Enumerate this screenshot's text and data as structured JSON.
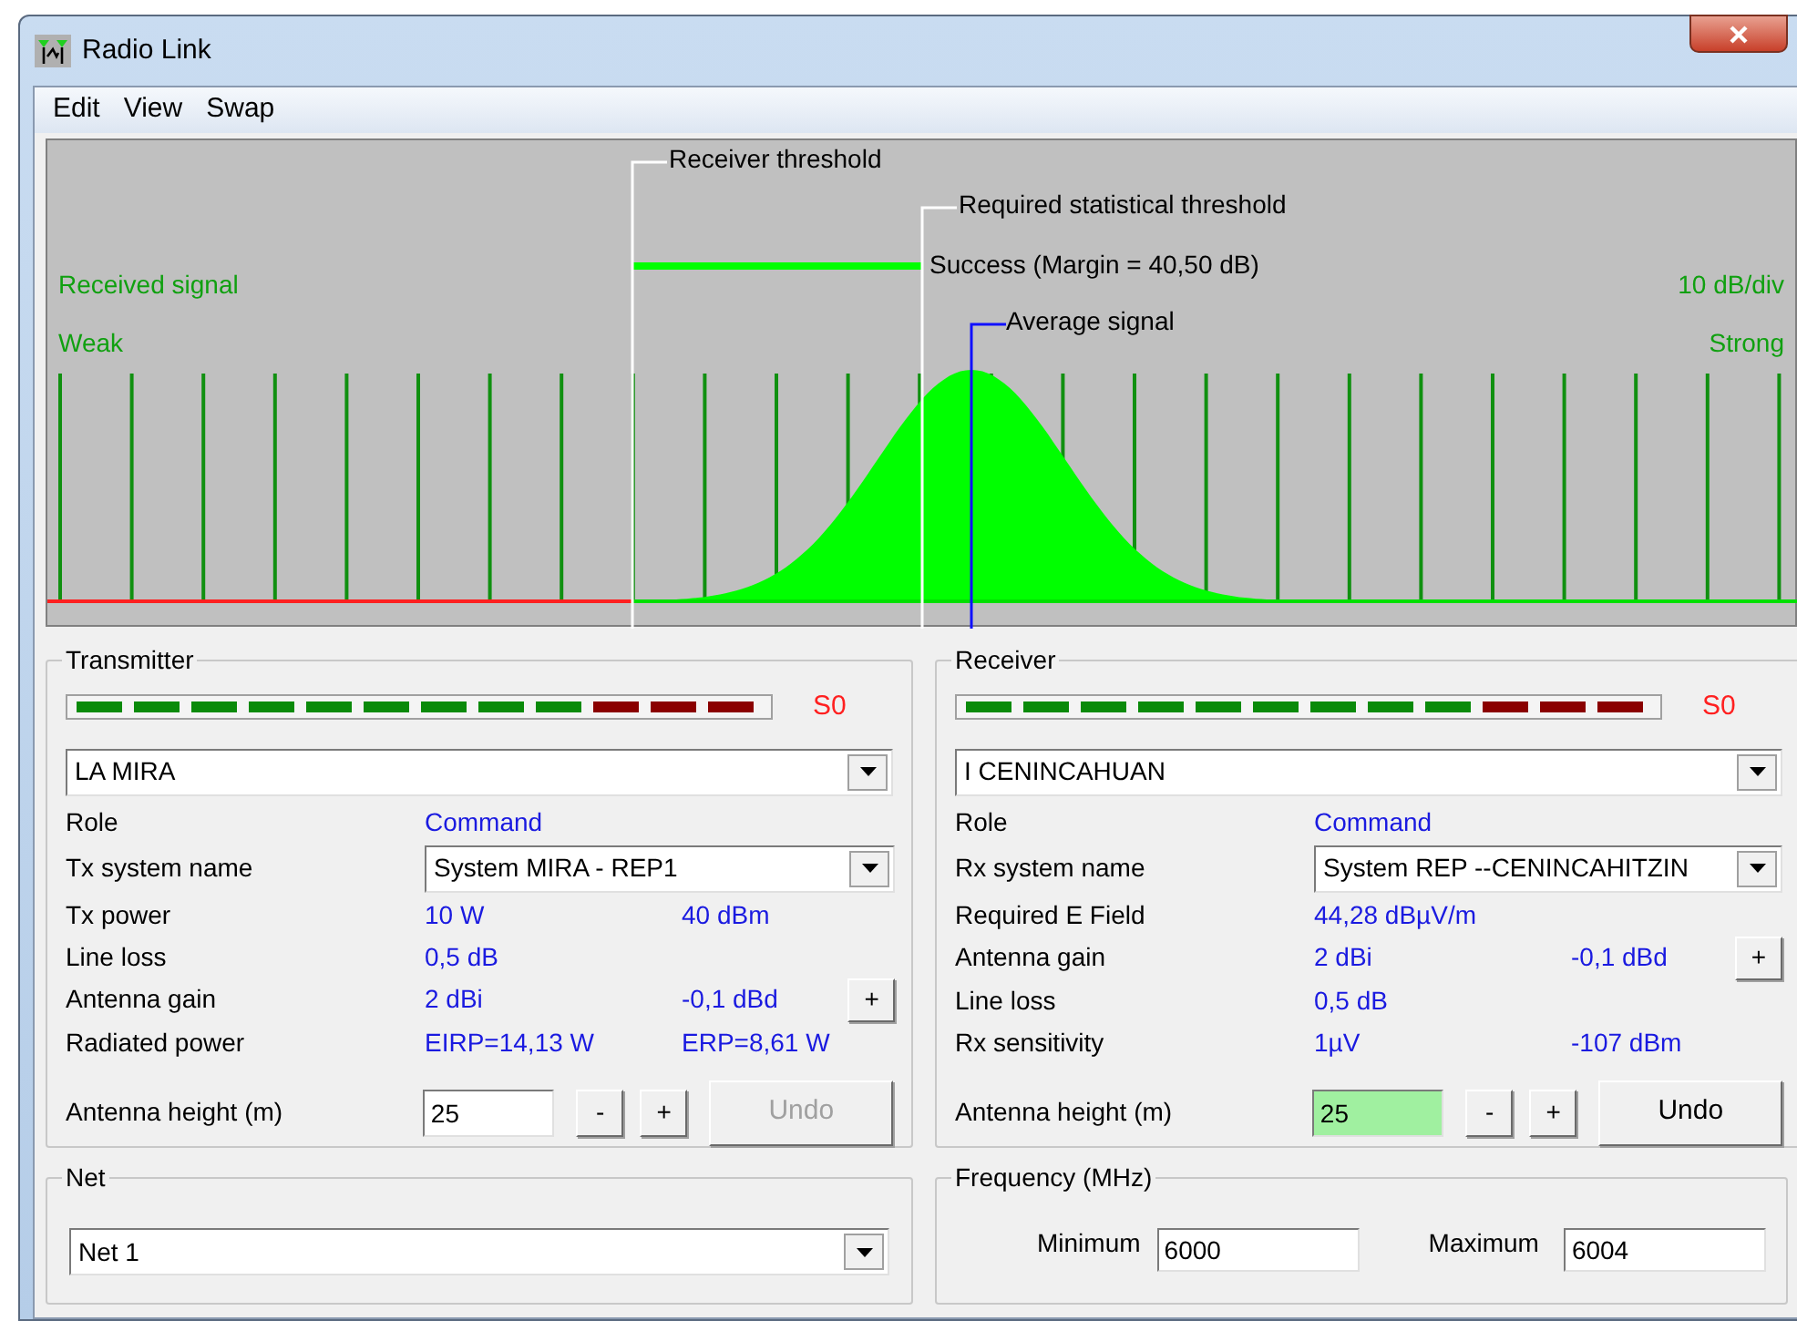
{
  "window": {
    "title": "Radio Link"
  },
  "menu": [
    "Edit",
    "View",
    "Swap"
  ],
  "chart": {
    "left_top": "Received signal",
    "left_bottom": "Weak",
    "right_top": "10 dB/div",
    "right_bottom": "Strong",
    "receiver_threshold": "Receiver threshold",
    "statistical_threshold": "Required statistical threshold",
    "result": "Success (Margin = 40,50 dB)",
    "average": "Average signal"
  },
  "transmitter": {
    "title": "Transmitter",
    "meter_reading": "S0",
    "site": "LA MIRA",
    "rows": [
      {
        "kind": "value",
        "label": "Role",
        "values": [
          "Command"
        ]
      },
      {
        "kind": "select",
        "label": "Tx system name",
        "value": "System MIRA - REP1"
      },
      {
        "kind": "value",
        "label": "Tx power",
        "values": [
          "10 W",
          "40 dBm"
        ]
      },
      {
        "kind": "value",
        "label": "Line loss",
        "values": [
          "0,5 dB"
        ]
      },
      {
        "kind": "value",
        "label": "Antenna gain",
        "values": [
          "2 dBi",
          "-0,1 dBd"
        ],
        "button": "+"
      },
      {
        "kind": "value",
        "label": "Radiated power",
        "values": [
          "EIRP=14,13 W",
          "ERP=8,61 W"
        ]
      }
    ],
    "height": {
      "label": "Antenna height (m)",
      "value": "25",
      "focused": false,
      "minus": "-",
      "plus": "+",
      "undo": "Undo",
      "undo_disabled": true
    }
  },
  "receiver": {
    "title": "Receiver",
    "meter_reading": "S0",
    "site": "I CENINCAHUAN",
    "rows": [
      {
        "kind": "value",
        "label": "Role",
        "values": [
          "Command"
        ]
      },
      {
        "kind": "select",
        "label": "Rx system name",
        "value": "System REP --CENINCAHITZIN"
      },
      {
        "kind": "value",
        "label": "Required E Field",
        "values": [
          "44,28 dBµV/m"
        ]
      },
      {
        "kind": "value",
        "label": "Antenna gain",
        "values": [
          "2 dBi",
          "-0,1 dBd"
        ],
        "button": "+"
      },
      {
        "kind": "value",
        "label": "Line loss",
        "values": [
          "0,5 dB"
        ]
      },
      {
        "kind": "value",
        "label": "Rx sensitivity",
        "values": [
          "1µV",
          "-107 dBm"
        ]
      }
    ],
    "height": {
      "label": "Antenna height (m)",
      "value": "25",
      "focused": true,
      "minus": "-",
      "plus": "+",
      "undo": "Undo",
      "undo_disabled": false
    }
  },
  "net": {
    "title": "Net",
    "value": "Net  1"
  },
  "frequency": {
    "title": "Frequency (MHz)",
    "minimum_label": "Minimum",
    "minimum": "6000",
    "maximum_label": "Maximum",
    "maximum": "6004"
  }
}
